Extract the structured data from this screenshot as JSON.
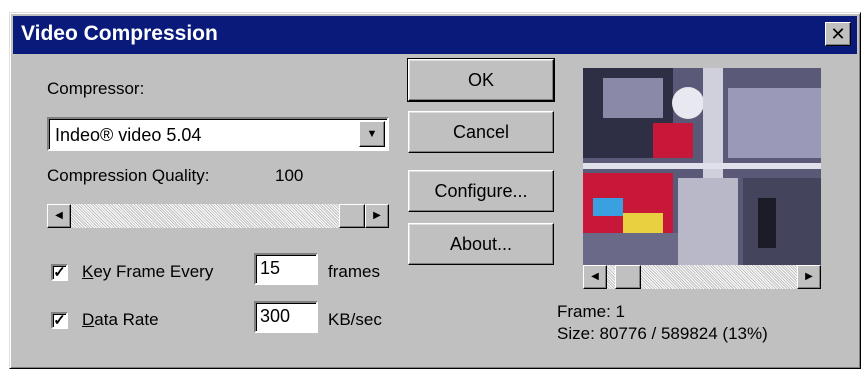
{
  "window": {
    "title": "Video Compression"
  },
  "compressor": {
    "label": "Compressor:",
    "value": "Indeo® video 5.04"
  },
  "quality": {
    "label": "Compression Quality:",
    "value": "100",
    "level": 1.0
  },
  "keyframe": {
    "checked": true,
    "label": "Key Frame Every",
    "value": "15",
    "unit": "frames"
  },
  "datarate": {
    "checked": true,
    "label": "Data Rate",
    "value": "300",
    "unit": "KB/sec"
  },
  "buttons": {
    "ok": "OK",
    "cancel": "Cancel",
    "configure": "Configure...",
    "about": "About..."
  },
  "preview": {
    "frame": "Frame: 1",
    "size": "Size: 80776 / 589824 (13%)",
    "scroll_position": 0.05
  },
  "icons": {
    "close": "close-icon",
    "dropdown": "chevron-down-icon",
    "left": "left-arrow-icon",
    "right": "right-arrow-icon"
  }
}
